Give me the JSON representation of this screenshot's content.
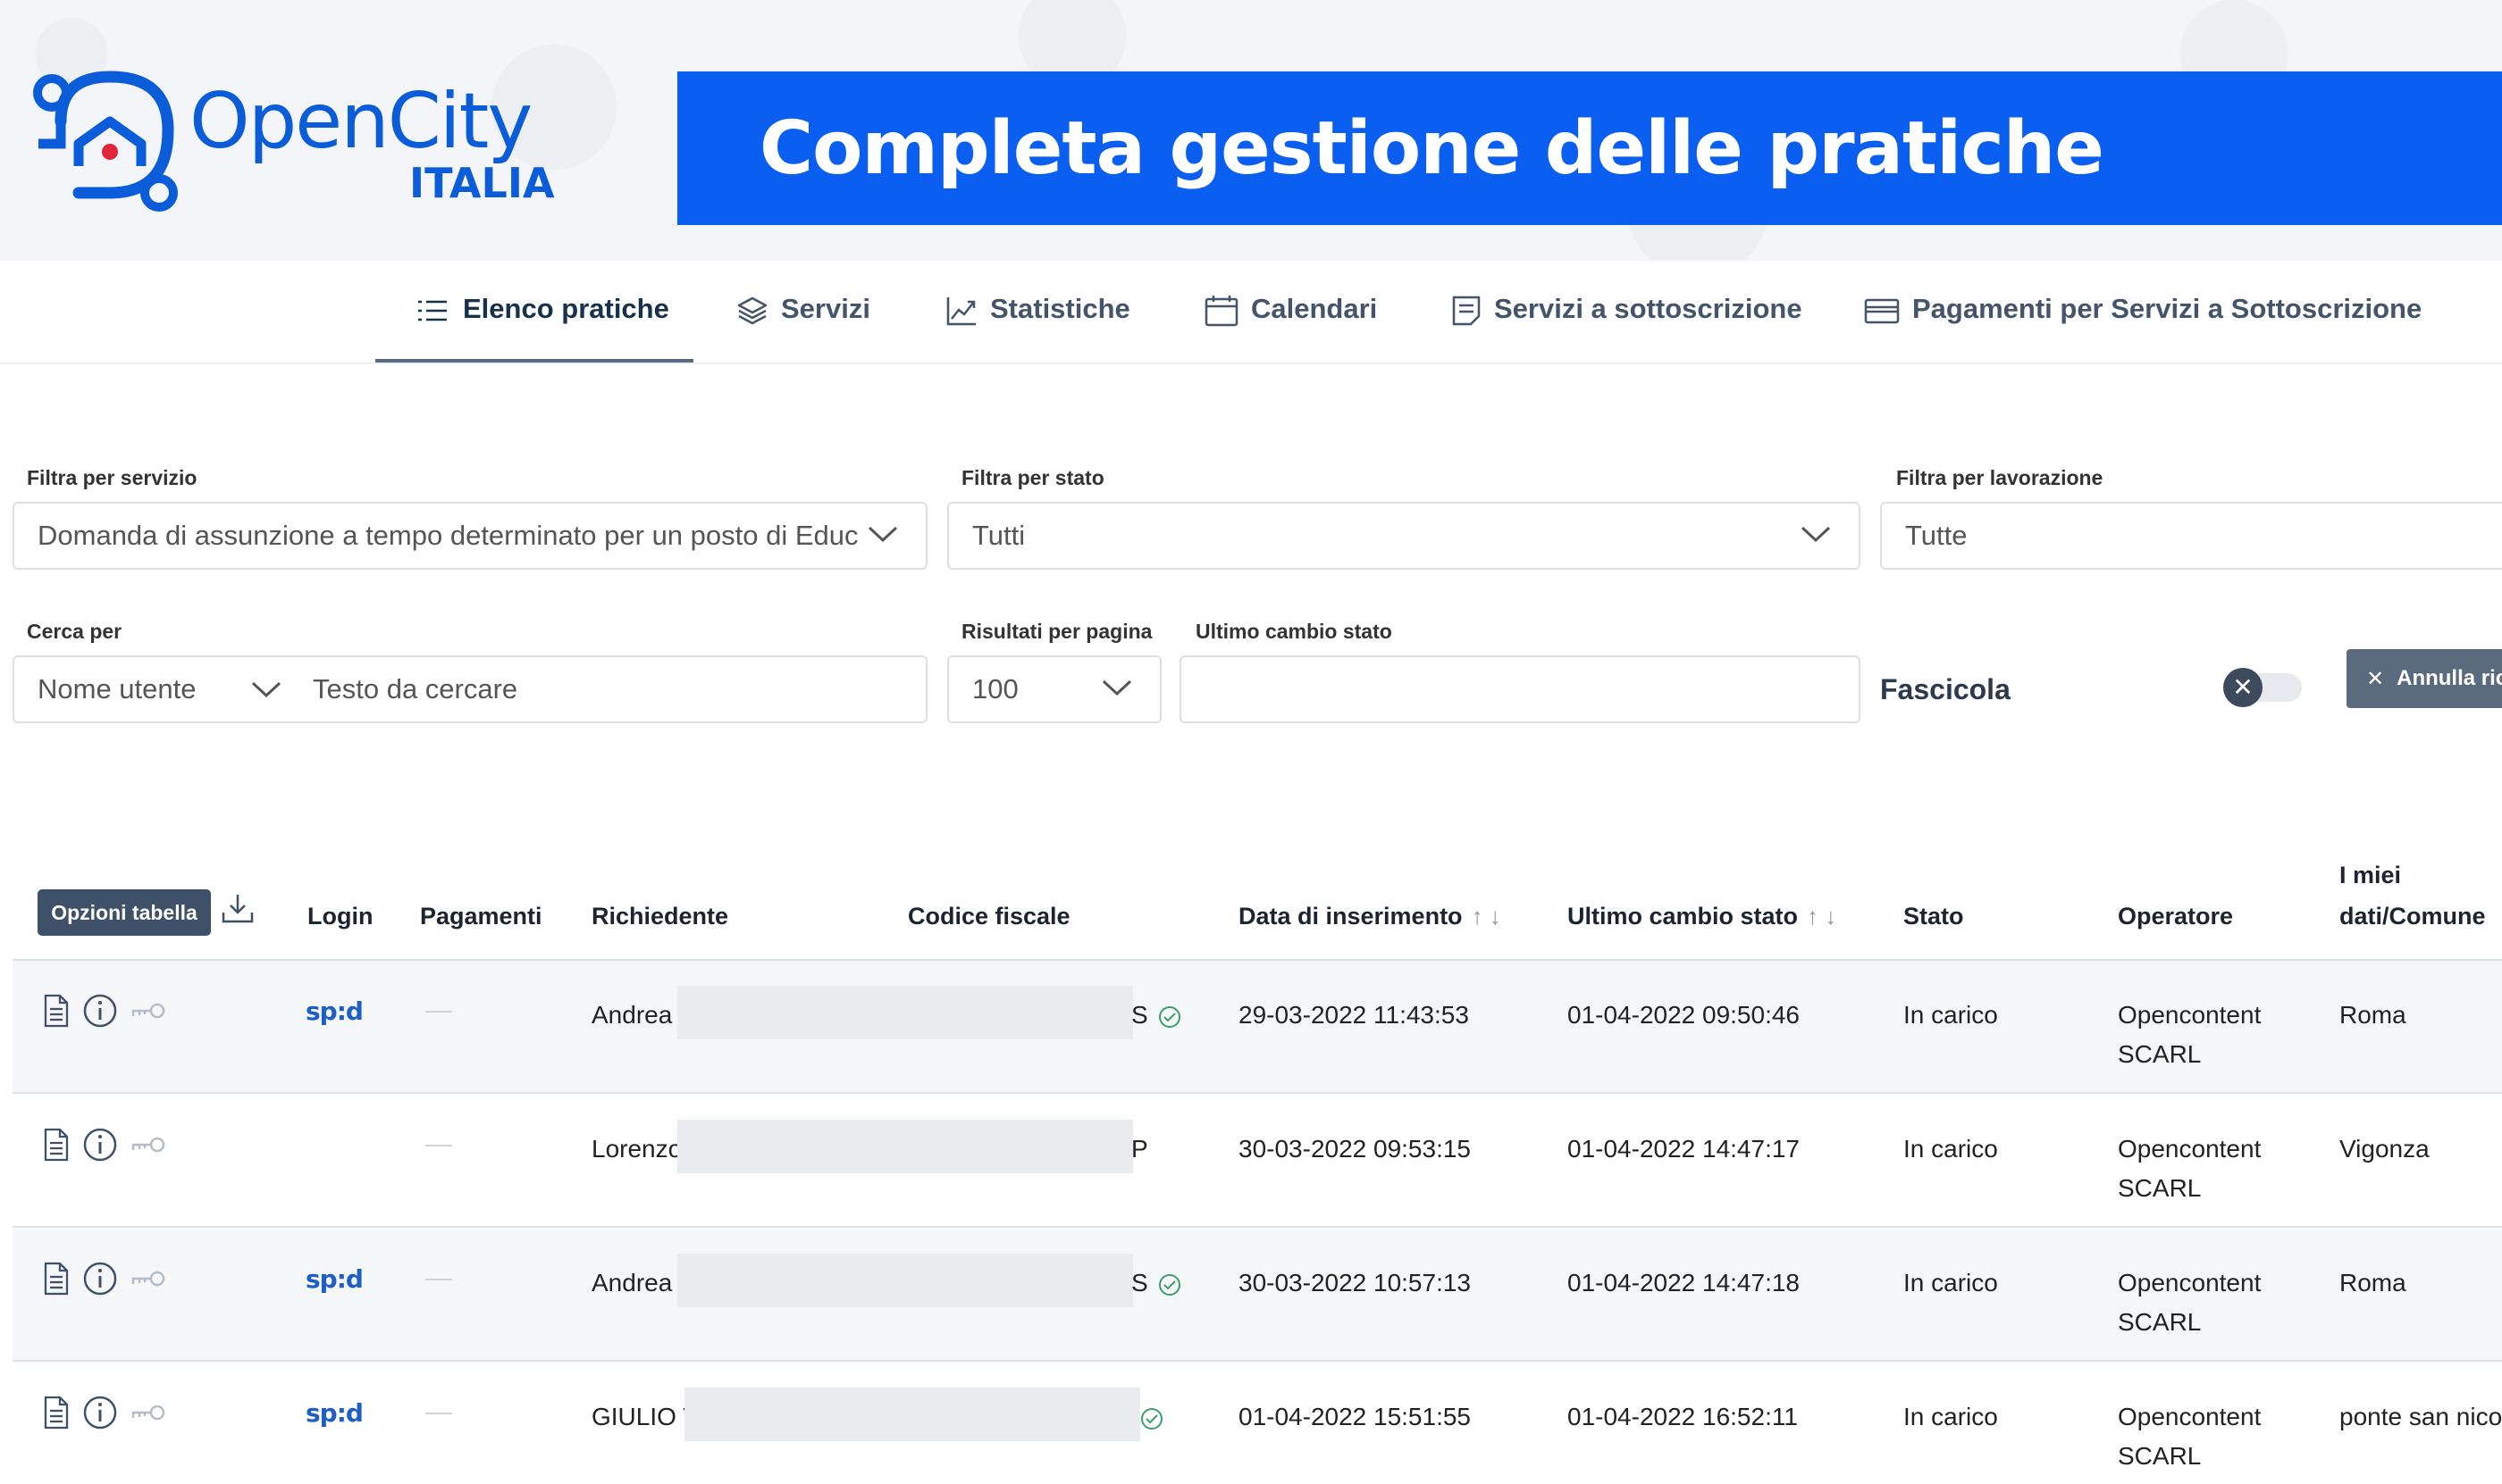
{
  "brand": {
    "name": "OpenCity",
    "sub": "ITALIA",
    "color": "#0b5cd8"
  },
  "banner": {
    "title": "Completa gestione delle pratiche",
    "color": "#0b5ff0"
  },
  "tabs": [
    {
      "label": "Elenco pratiche",
      "icon": "list-icon",
      "active": true
    },
    {
      "label": "Servizi",
      "icon": "layers-icon"
    },
    {
      "label": "Statistiche",
      "icon": "chart-line-icon"
    },
    {
      "label": "Calendari",
      "icon": "calendar-icon"
    },
    {
      "label": "Servizi a sottoscrizione",
      "icon": "document-icon"
    },
    {
      "label": "Pagamenti per Servizi a Sottoscrizione",
      "icon": "credit-card-icon"
    }
  ],
  "filters": {
    "servizio": {
      "label": "Filtra per servizio",
      "value": "Domanda di assunzione a tempo determinato per un posto di Educ"
    },
    "stato": {
      "label": "Filtra per stato",
      "value": "Tutti"
    },
    "lavorazione": {
      "label": "Filtra per lavorazione",
      "value": "Tutte"
    },
    "cerca": {
      "label": "Cerca per",
      "field": "Nome utente",
      "placeholder": "Testo da cercare"
    },
    "risultati": {
      "label": "Risultati per pagina",
      "value": "100"
    },
    "ultimo": {
      "label": "Ultimo cambio stato",
      "value": ""
    },
    "fascicola": "Fascicola",
    "annulla": "Annulla rice"
  },
  "table": {
    "options_label": "Opzioni tabella",
    "headers": {
      "login": "Login",
      "pagamenti": "Pagamenti",
      "richiedente": "Richiedente",
      "codice": "Codice fiscale",
      "data": "Data di inserimento",
      "ultimo": "Ultimo cambio stato",
      "stato": "Stato",
      "operatore": "Operatore",
      "comune_1": "I miei",
      "comune_2": "dati/Comune"
    },
    "sort_arrows": "↑ ↓",
    "rows": [
      {
        "login": "sp:d",
        "richiedente": "Andrea I",
        "codice": "S",
        "verified": true,
        "data": "29-03-2022 11:43:53",
        "ultimo": "01-04-2022 09:50:46",
        "stato": "In carico",
        "operatore_1": "Opencontent",
        "operatore_2": "SCARL",
        "comune": "Roma"
      },
      {
        "login": "",
        "richiedente": "Lorenzo",
        "codice": "P",
        "verified": false,
        "data": "30-03-2022 09:53:15",
        "ultimo": "01-04-2022 14:47:17",
        "stato": "In carico",
        "operatore_1": "Opencontent",
        "operatore_2": "SCARL",
        "comune": "Vigonza"
      },
      {
        "login": "sp:d",
        "richiedente": "Andrea I",
        "codice": "S",
        "verified": true,
        "data": "30-03-2022 10:57:13",
        "ultimo": "01-04-2022 14:47:18",
        "stato": "In carico",
        "operatore_1": "Opencontent",
        "operatore_2": "SCARL",
        "comune": "Roma"
      },
      {
        "login": "sp:d",
        "richiedente": "GIULIO T",
        "codice": "",
        "verified": true,
        "data": "01-04-2022 15:51:55",
        "ultimo": "01-04-2022 16:52:11",
        "stato": "In carico",
        "operatore_1": "Opencontent",
        "operatore_2": "SCARL",
        "comune": "ponte san nicol"
      }
    ]
  }
}
